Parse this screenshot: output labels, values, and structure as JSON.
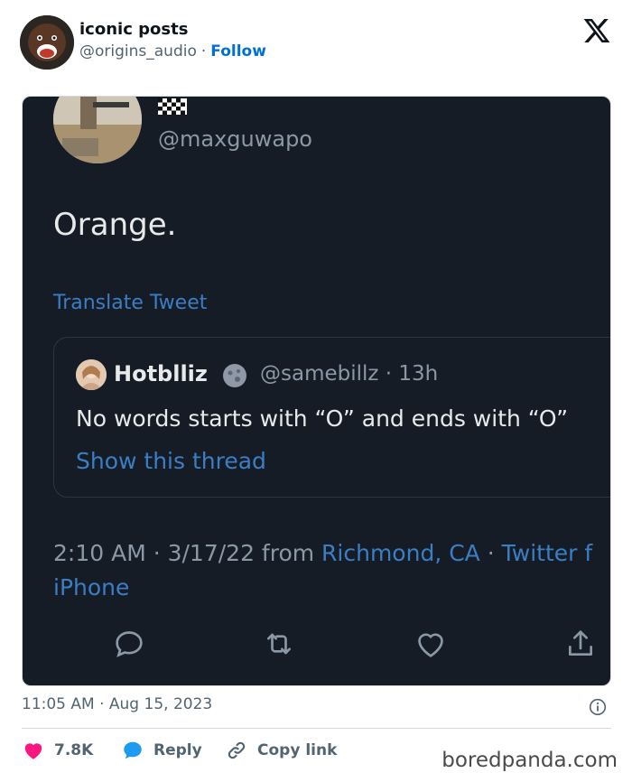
{
  "author": {
    "name": "iconic posts",
    "handle": "@origins_audio",
    "separator": "·",
    "follow_label": "Follow"
  },
  "screenshot": {
    "handle": "@maxguwapo",
    "text": "Orange.",
    "translate_label": "Translate Tweet",
    "quote": {
      "name": "Hotblliz",
      "handle_time": "@samebillz · 13h",
      "text": "No words starts with “O” and ends with “O”",
      "thread_label": "Show this thread"
    },
    "meta": {
      "time_date": "2:10 AM · 3/17/22 from ",
      "location": "Richmond, CA",
      "sep": " · ",
      "source_part1": "Twitter f",
      "source_part2": "iPhone"
    },
    "actions_icons": [
      "reply-icon",
      "retweet-icon",
      "like-icon",
      "share-icon"
    ]
  },
  "footer": {
    "timestamp": "11:05 AM · Aug 15, 2023",
    "likes_count": "7.8K",
    "reply_label": "Reply",
    "copy_link_label": "Copy link"
  },
  "watermark": "boredpanda.com",
  "colors": {
    "follow": "#006fd6",
    "heart": "#f91880",
    "reply_bubble": "#1d9bf0",
    "screenshot_bg": "#151c26",
    "screenshot_link": "#3b7ec4"
  }
}
